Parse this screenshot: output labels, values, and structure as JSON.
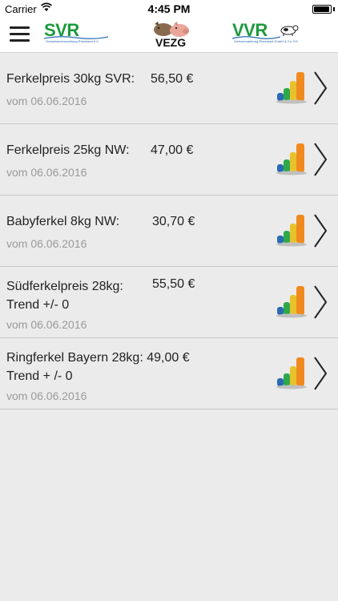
{
  "status_bar": {
    "carrier": "Carrier",
    "time": "4:45 PM"
  },
  "header": {
    "logos": {
      "svr_text": "SVR",
      "svr_sub": "Schweinevermarktung Rheinland e.V.",
      "vezg_text": "VEZG",
      "vvr_text": "VVR",
      "vvr_sub": "Viehvermarktung Rheinland GmbH & Co. KG"
    }
  },
  "colors": {
    "logo_green": "#1c9a3c",
    "logo_blue": "#2a6ab3",
    "date_gray": "#9a9a9a"
  },
  "items": [
    {
      "title": "Ferkelpreis 30kg SVR:",
      "title_line2": "",
      "price": "56,50 €",
      "date": "vom 06.06.2016"
    },
    {
      "title": "Ferkelpreis 25kg NW:",
      "title_line2": "",
      "price": "47,00 €",
      "date": "vom 06.06.2016"
    },
    {
      "title": "Babyferkel 8kg NW:",
      "title_line2": "",
      "price": "30,70 €",
      "date": "vom 06.06.2016"
    },
    {
      "title": "Südferkelpreis 28kg:",
      "title_line2": "Trend +/- 0",
      "price": "55,50 €",
      "date": "vom 06.06.2016"
    },
    {
      "title": "Ringferkel Bayern 28kg:",
      "title_line2": "Trend + /- 0",
      "price": "49,00 €",
      "date": "vom 06.06.2016"
    }
  ]
}
